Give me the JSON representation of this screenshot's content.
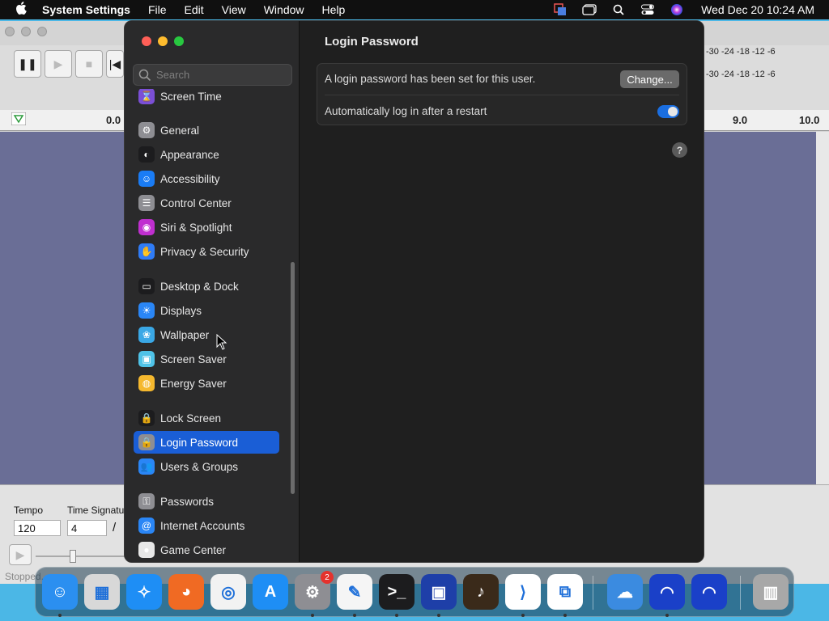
{
  "menubar": {
    "app_name": "System Settings",
    "menus": [
      "File",
      "Edit",
      "View",
      "Window",
      "Help"
    ],
    "clock": "Wed Dec 20  10:24 AM",
    "status_icons": [
      "screen-mirror-icon",
      "window-icon",
      "search-icon",
      "control-center-icon",
      "siri-icon"
    ]
  },
  "background_app": {
    "ruler_ticks": [
      "0.0",
      "9.0",
      "10.0"
    ],
    "meter_scale": "-30 -24 -18 -12 -6",
    "tempo_label": "Tempo",
    "tempo_value": "120",
    "time_signature_label": "Time Signatu",
    "time_signature_value": "4",
    "time_signature_slash": "/",
    "status": "Stopped."
  },
  "settings": {
    "search_placeholder": "Search",
    "sidebar_items": [
      {
        "label": "Screen Time",
        "icon": "hourglass-icon",
        "color": "#7b4fd6"
      },
      {
        "label": "General",
        "icon": "gear-icon",
        "color": "#8e8e93"
      },
      {
        "label": "Appearance",
        "icon": "appearance-icon",
        "color": "#1c1c1e"
      },
      {
        "label": "Accessibility",
        "icon": "accessibility-icon",
        "color": "#1a7cf5"
      },
      {
        "label": "Control Center",
        "icon": "control-center-icon",
        "color": "#8e8e93"
      },
      {
        "label": "Siri & Spotlight",
        "icon": "siri-icon",
        "color": "#c02fd0"
      },
      {
        "label": "Privacy & Security",
        "icon": "hand-icon",
        "color": "#2f7cf6"
      },
      {
        "label": "Desktop & Dock",
        "icon": "dock-icon",
        "color": "#1c1c1e"
      },
      {
        "label": "Displays",
        "icon": "sun-icon",
        "color": "#2a86f6"
      },
      {
        "label": "Wallpaper",
        "icon": "flower-icon",
        "color": "#3aa8e6"
      },
      {
        "label": "Screen Saver",
        "icon": "screen-saver-icon",
        "color": "#4fc3e8"
      },
      {
        "label": "Energy Saver",
        "icon": "lightbulb-icon",
        "color": "#f5b82e"
      },
      {
        "label": "Lock Screen",
        "icon": "lock-icon",
        "color": "#1c1c1e"
      },
      {
        "label": "Login Password",
        "icon": "lock-icon",
        "color": "#8e8e93"
      },
      {
        "label": "Users & Groups",
        "icon": "users-icon",
        "color": "#2a86f6"
      },
      {
        "label": "Passwords",
        "icon": "key-icon",
        "color": "#8e8e93"
      },
      {
        "label": "Internet Accounts",
        "icon": "at-icon",
        "color": "#2a86f6"
      },
      {
        "label": "Game Center",
        "icon": "game-center-icon",
        "color": "#e8e8e8"
      }
    ],
    "selected": "Login Password",
    "page_title": "Login Password",
    "row1_text": "A login password has been set for this user.",
    "change_label": "Change...",
    "row2_text": "Automatically log in after a restart",
    "auto_login_enabled": true,
    "help_label": "?"
  },
  "dock": {
    "apps": [
      {
        "name": "Finder",
        "color": "#2b8ff0"
      },
      {
        "name": "Launchpad",
        "color": "#d8d8d8"
      },
      {
        "name": "Safari",
        "color": "#1e8ef5"
      },
      {
        "name": "Firefox",
        "color": "#f06a23"
      },
      {
        "name": "Chrome",
        "color": "#f2f2f2"
      },
      {
        "name": "App Store",
        "color": "#1e8ef5"
      },
      {
        "name": "System Settings",
        "color": "#8e8e93",
        "badge": "2"
      },
      {
        "name": "TextEdit",
        "color": "#f5f5f5"
      },
      {
        "name": "Terminal",
        "color": "#1c1c1e"
      },
      {
        "name": "Screens",
        "color": "#1e3fa8"
      },
      {
        "name": "GarageBand",
        "color": "#3a2a1a"
      },
      {
        "name": "VS Code",
        "color": "#ffffff"
      },
      {
        "name": "Screen Sharing",
        "color": "#ffffff"
      },
      {
        "name": "Weather",
        "color": "#3b8be0"
      },
      {
        "name": "Audacity",
        "color": "#1a40c8"
      },
      {
        "name": "Audacity 2",
        "color": "#1a40c8"
      },
      {
        "name": "Trash",
        "color": "#a8a8a8"
      }
    ]
  }
}
